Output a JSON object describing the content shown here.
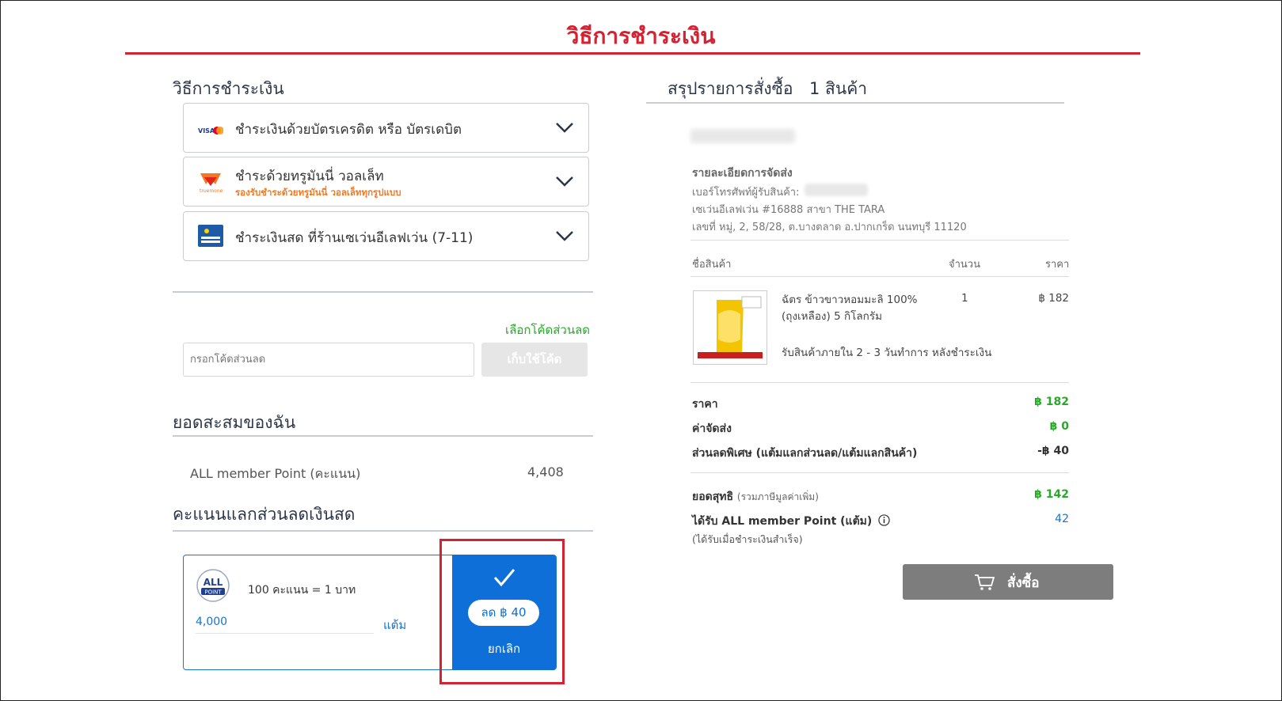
{
  "page_title": "วิธีการชำระเงิน",
  "left": {
    "section_title": "วิธีการชำระเงิน",
    "methods": [
      {
        "label": "ชำระเงินด้วยบัตรเครดิต หรือ บัตรเดบิต",
        "icon": "visa-mastercard-icon",
        "sub": ""
      },
      {
        "label": "ชำระด้วยทรูมันนี่ วอลเล็ท",
        "icon": "truemoney-icon",
        "sub": "รองรับชำระด้วยทรูมันนี่ วอลเล็ททุกรูปแบบ"
      },
      {
        "label": "ชำระเงินสด ที่ร้านเซเว่นอีเลฟเว่น (7-11)",
        "icon": "counter-service-icon",
        "sub": ""
      }
    ],
    "coupon": {
      "select_link": "เลือกโค้ดส่วนลด",
      "placeholder": "กรอกโค้ดส่วนลด",
      "apply_label": "เก็บใช้โค้ด"
    },
    "points_section_title": "ยอดสะสมของฉัน",
    "points_label": "ALL member Point (คะแนน)",
    "points_value": "4,408",
    "redeem_title": "คะแนนแลกส่วนลดเงินสด",
    "redeem": {
      "logo_text_top": "ALL",
      "logo_text_bottom": "POINT",
      "rate": "100 คะแนน = 1 บาท",
      "amount": "4,000",
      "unit": "แต้ม",
      "discount": "ลด ฿ 40",
      "cancel": "ยกเลิก"
    }
  },
  "right": {
    "summary_title": "สรุปรายการสั่งซื้อ",
    "item_count": "1 สินค้า",
    "shipping_title": "รายละเอียดการจัดส่ง",
    "phone_label": "เบอร์โทรศัพท์ผู้รับสินค้า:",
    "store": "เซเว่นอีเลฟเว่น #16888 สาขา THE TARA",
    "address": "เลขที่ หมู่, 2, 58/28, ต.บางตลาด อ.ปากเกร็ด นนทบุรี 11120",
    "table_headers": {
      "name": "ชื่อสินค้า",
      "qty": "จำนวน",
      "price": "ราคา"
    },
    "product": {
      "name": "ฉัตร ข้าวขาวหอมมะลิ 100% (ถุงเหลือง) 5 กิโลกรัม",
      "qty": "1",
      "price": "฿ 182",
      "delivery_note": "รับสินค้าภายใน 2 - 3 วันทำการ หลังชำระเงิน"
    },
    "totals": [
      {
        "label": "ราคา",
        "value": "฿ 182"
      },
      {
        "label": "ค่าจัดส่ง",
        "value": "฿ 0"
      },
      {
        "label": "ส่วนลดพิเศษ (แต้มแลกส่วนลด/แต้มแลกสินค้า)",
        "value": "-฿ 40"
      }
    ],
    "net_label": "ยอดสุทธิ",
    "net_note": "(รวมภาษีมูลค่าเพิ่ม)",
    "net_value": "฿ 142",
    "earn_label": "ได้รับ ALL member Point (แต้ม)",
    "earn_note": "(ได้รับเมื่อชำระเงินสำเร็จ)",
    "earn_value": "42",
    "order_button": "สั่งซื้อ"
  },
  "colors": {
    "brand_red": "#d42233",
    "primary_blue": "#0e6fd8",
    "success_green": "#2aa72a"
  }
}
